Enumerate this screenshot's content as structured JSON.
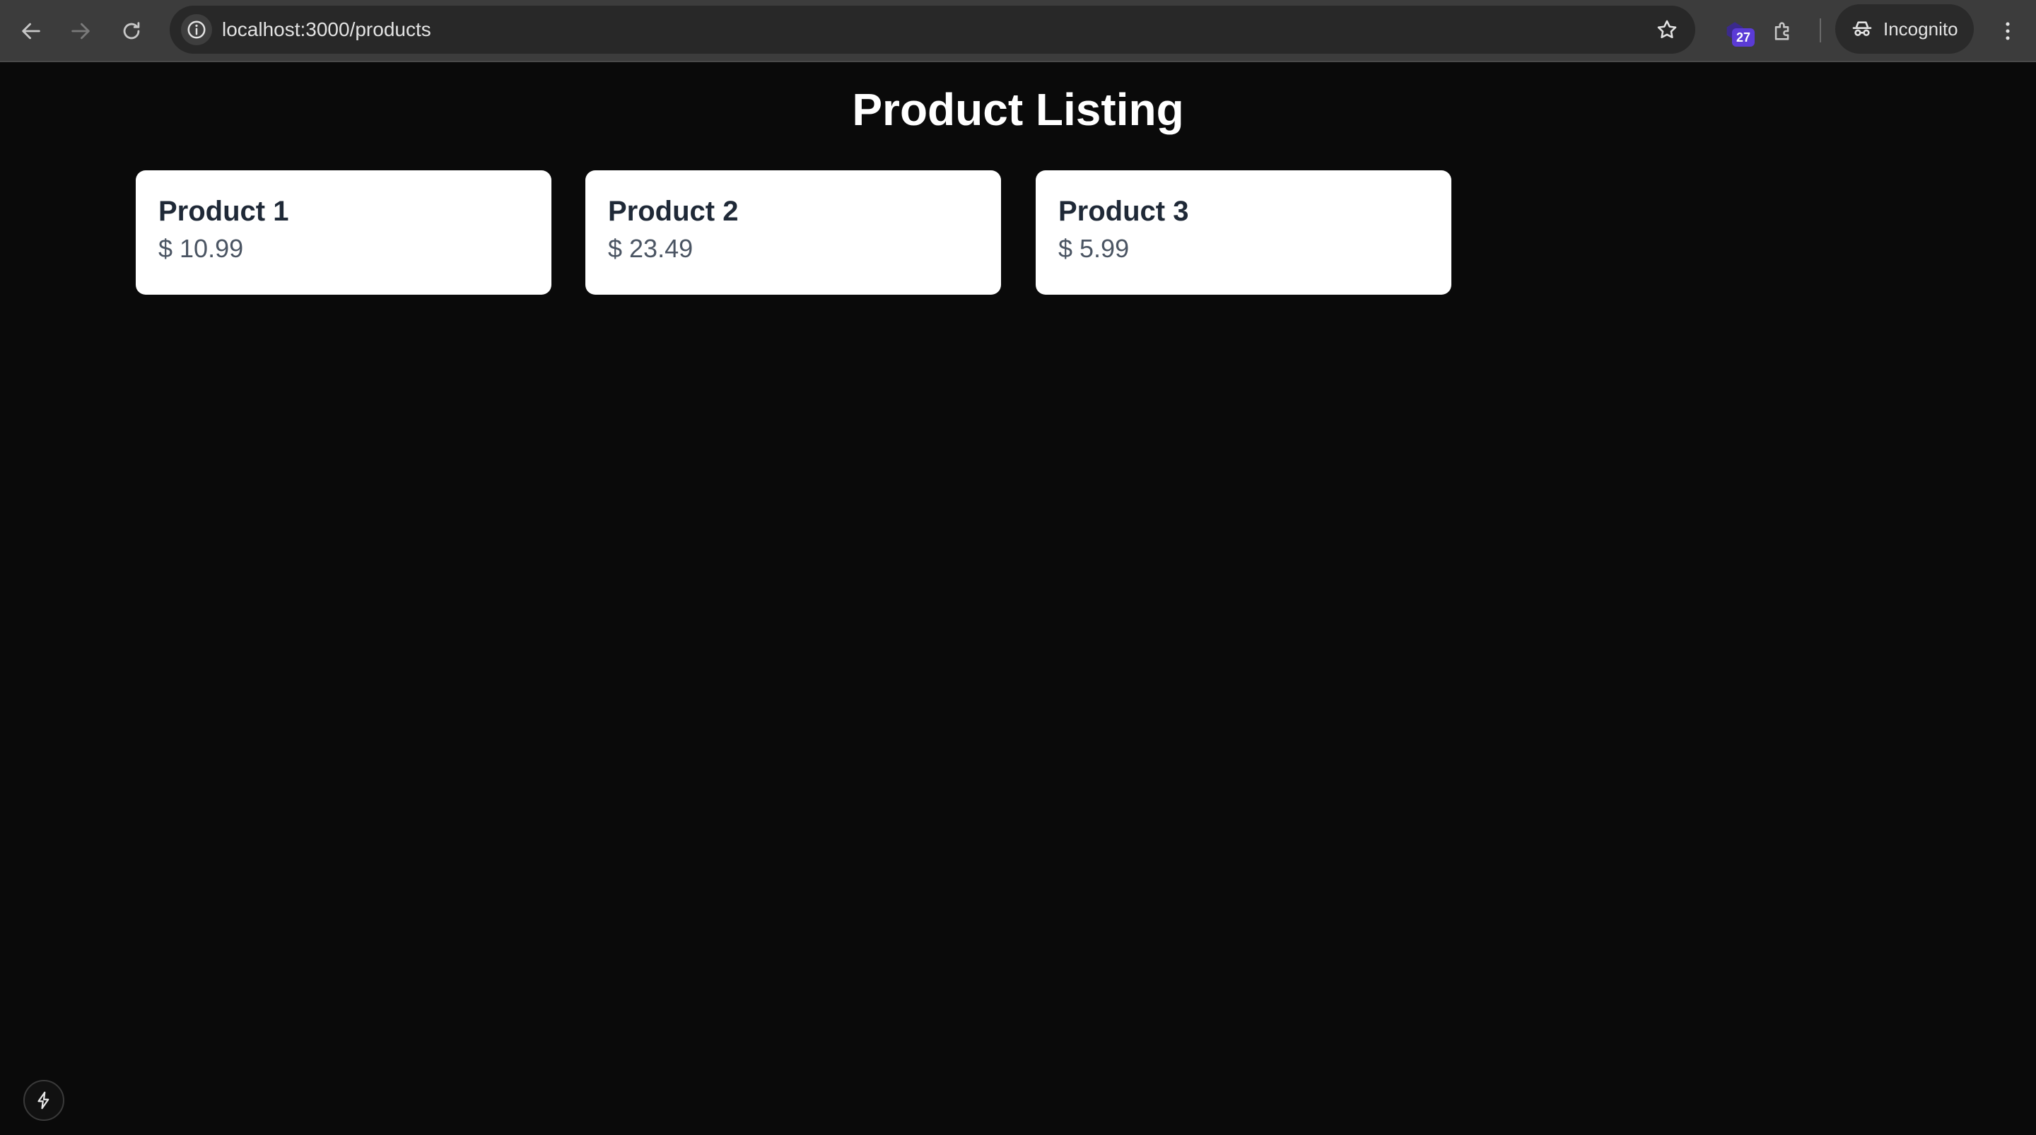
{
  "browser": {
    "url": "localhost:3000/products",
    "extension_badge_count": "27",
    "incognito_label": "Incognito",
    "icons": {
      "back": "back-arrow-icon",
      "forward": "forward-arrow-icon",
      "reload": "reload-icon",
      "site_info": "info-icon",
      "bookmark": "star-icon",
      "extensions": "puzzle-icon",
      "incognito": "incognito-icon",
      "menu": "kebab-menu-icon"
    },
    "colors": {
      "chrome_bg": "#3c3c3c",
      "omnibox_bg": "#282828",
      "badge_bg": "#5b3bd6"
    }
  },
  "page": {
    "title": "Product Listing",
    "background": "#0a0a0a",
    "products": [
      {
        "name": "Product 1",
        "price": "$ 10.99"
      },
      {
        "name": "Product 2",
        "price": "$ 23.49"
      },
      {
        "name": "Product 3",
        "price": "$ 5.99"
      }
    ]
  },
  "devtools": {
    "icon": "lightning-icon"
  }
}
